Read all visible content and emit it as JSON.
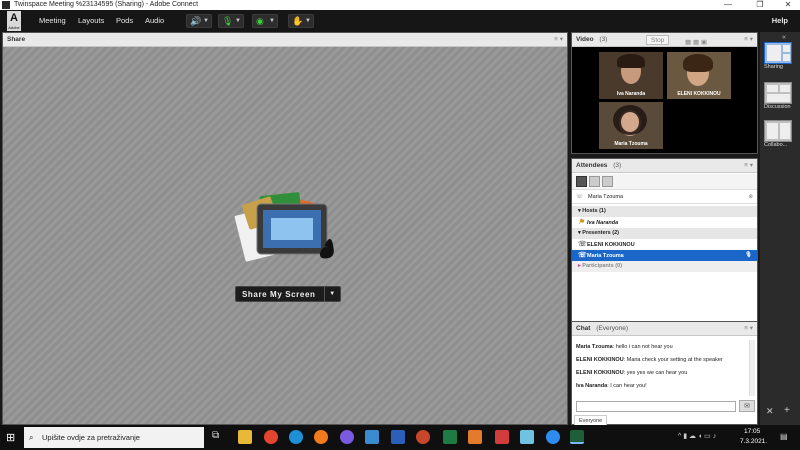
{
  "window": {
    "title": "Twinspace Meeting %23134595 (Sharing) - Adobe Connect",
    "controls": [
      "—",
      "❐",
      "✕"
    ]
  },
  "menubar": {
    "logo_text": "A",
    "logo_sub": "Adobe",
    "items": [
      "Meeting",
      "Layouts",
      "Pods",
      "Audio"
    ],
    "help": "Help"
  },
  "share_pod": {
    "title": "Share",
    "button_label": "Share My Screen",
    "button_arrow": "▼"
  },
  "video_pod": {
    "title": "Video",
    "count": "(3)",
    "stop_label": "Stop",
    "participants": [
      "Iva Naranda",
      "ELENI KOKKINOU",
      "Maria Tzouma"
    ]
  },
  "attendees_pod": {
    "title": "Attendees",
    "count": "(3)",
    "current_user": "Maria Tzouma",
    "groups": {
      "hosts": {
        "label": "Hosts (1)",
        "members": [
          "Iva Naranda"
        ]
      },
      "presenters": {
        "label": "Presenters (2)",
        "members": [
          "ELENI KOKKINOU",
          "Maria Tzouma"
        ]
      },
      "participants": {
        "label": "Participants (0)"
      }
    }
  },
  "chat_pod": {
    "title": "Chat",
    "scope": "(Everyone)",
    "messages": [
      {
        "sender": "Maria Tzouma",
        "text": "hello i can not hear you"
      },
      {
        "sender": "ELENI KOKKINOU",
        "text": "Maria check your setting at the speaker"
      },
      {
        "sender": "ELENI KOKKINOU",
        "text": "yes yes we can hear you"
      },
      {
        "sender": "Iva Naranda",
        "text": "I can hear you!"
      }
    ],
    "input_placeholder": "",
    "tab": "Everyone"
  },
  "layouts": [
    "Sharing",
    "Discussion",
    "Collabo..."
  ],
  "taskbar": {
    "search_placeholder": "Upišite ovdje za pretraživanje",
    "time": "17:05",
    "date": "7.3.2021."
  },
  "colors": {
    "accent_selected": "#1b66c9",
    "menubar": "#161616"
  }
}
